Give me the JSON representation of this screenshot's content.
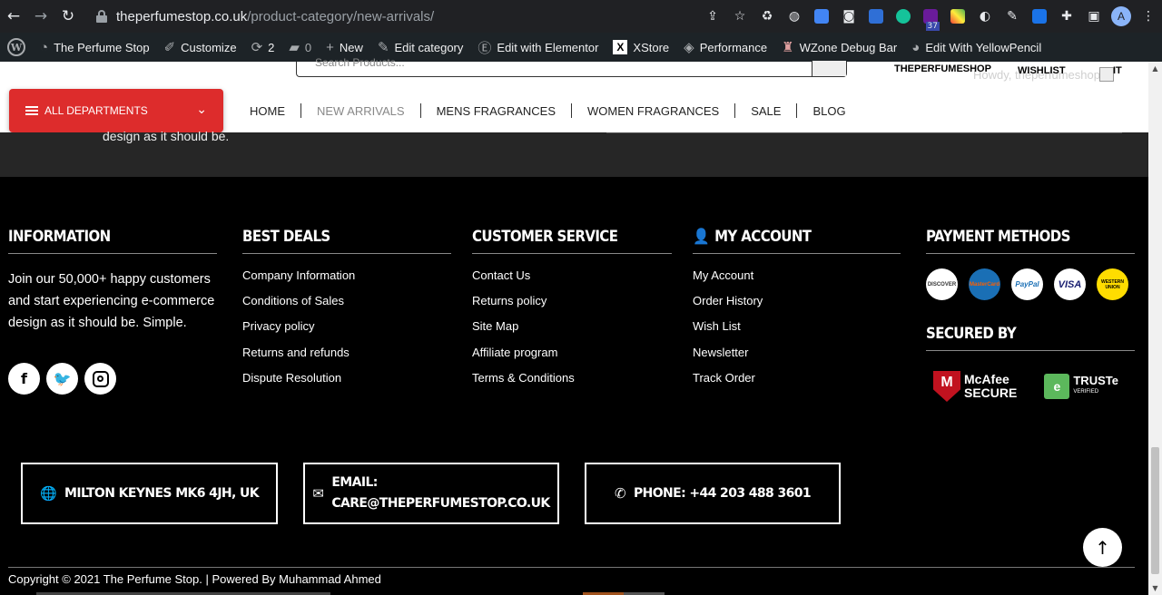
{
  "browser": {
    "url_domain": "theperfumestop.co.uk",
    "url_path": "/product-category/new-arrivals/",
    "ext_badge": "37",
    "profile_initial": "A"
  },
  "adminbar": {
    "site_name": "The Perfume Stop",
    "customize": "Customize",
    "updates": "2",
    "comments": "0",
    "new": "New",
    "edit_category": "Edit category",
    "elementor": "Edit with Elementor",
    "xstore": "XStore",
    "performance": "Performance",
    "wzone": "WZone Debug Bar",
    "yellowpencil": "Edit With YellowPencil"
  },
  "header": {
    "search_placeholder": "Search Products...",
    "brand": "THEPERFUMESHOP",
    "wishlist": "WISHLIST",
    "howdy": "Howdy, theperfumeshop",
    "cart_frag": "IT",
    "all_departments": "ALL DEPARTMENTS",
    "nav": [
      "HOME",
      "NEW ARRIVALS",
      "MENS FRAGRANCES",
      "WOMEN FRAGRANCES",
      "SALE",
      "BLOG"
    ]
  },
  "strip": {
    "text": "design as it should be."
  },
  "footer": {
    "information": {
      "title": "INFORMATION",
      "text": "Join our 50,000+ happy customers and start experiencing e-commerce design as it should be. Simple."
    },
    "best_deals": {
      "title": "BEST DEALS",
      "links": [
        "Company Information",
        "Conditions of Sales",
        "Privacy policy",
        "Returns and refunds",
        "Dispute Resolution"
      ]
    },
    "customer_service": {
      "title": "CUSTOMER SERVICE",
      "links": [
        "Contact Us",
        "Returns policy",
        "Site Map",
        "Affiliate program",
        "Terms & Conditions"
      ]
    },
    "my_account": {
      "title": "MY ACCOUNT",
      "links": [
        "My Account",
        "Order History",
        "Wish List",
        "Newsletter",
        "Track Order"
      ]
    },
    "payment": {
      "title": "PAYMENT METHODS",
      "methods": [
        "DISCOVER",
        "MasterCard",
        "PayPal",
        "VISA",
        "WESTERN UNION"
      ],
      "secured_title": "SECURED BY",
      "mcafee_1": "McAfee",
      "mcafee_2": "SECURE",
      "truste_1": "TRUSTe",
      "truste_2": "VERIFIED"
    },
    "contacts": {
      "address": "MILTON KEYNES MK6 4JH, UK",
      "email_label": "EMAIL:",
      "email": "CARE@THEPERFUMESTOP.CO.UK",
      "phone": "PHONE: +44 203 488 3601"
    },
    "copyright": "Copyright © 2021 The Perfume Stop. | Powered By Muhammad Ahmed"
  },
  "colors": {
    "accent": "#dd2c2c",
    "footer_bg": "#000000",
    "admin_bg": "#1d2327"
  }
}
